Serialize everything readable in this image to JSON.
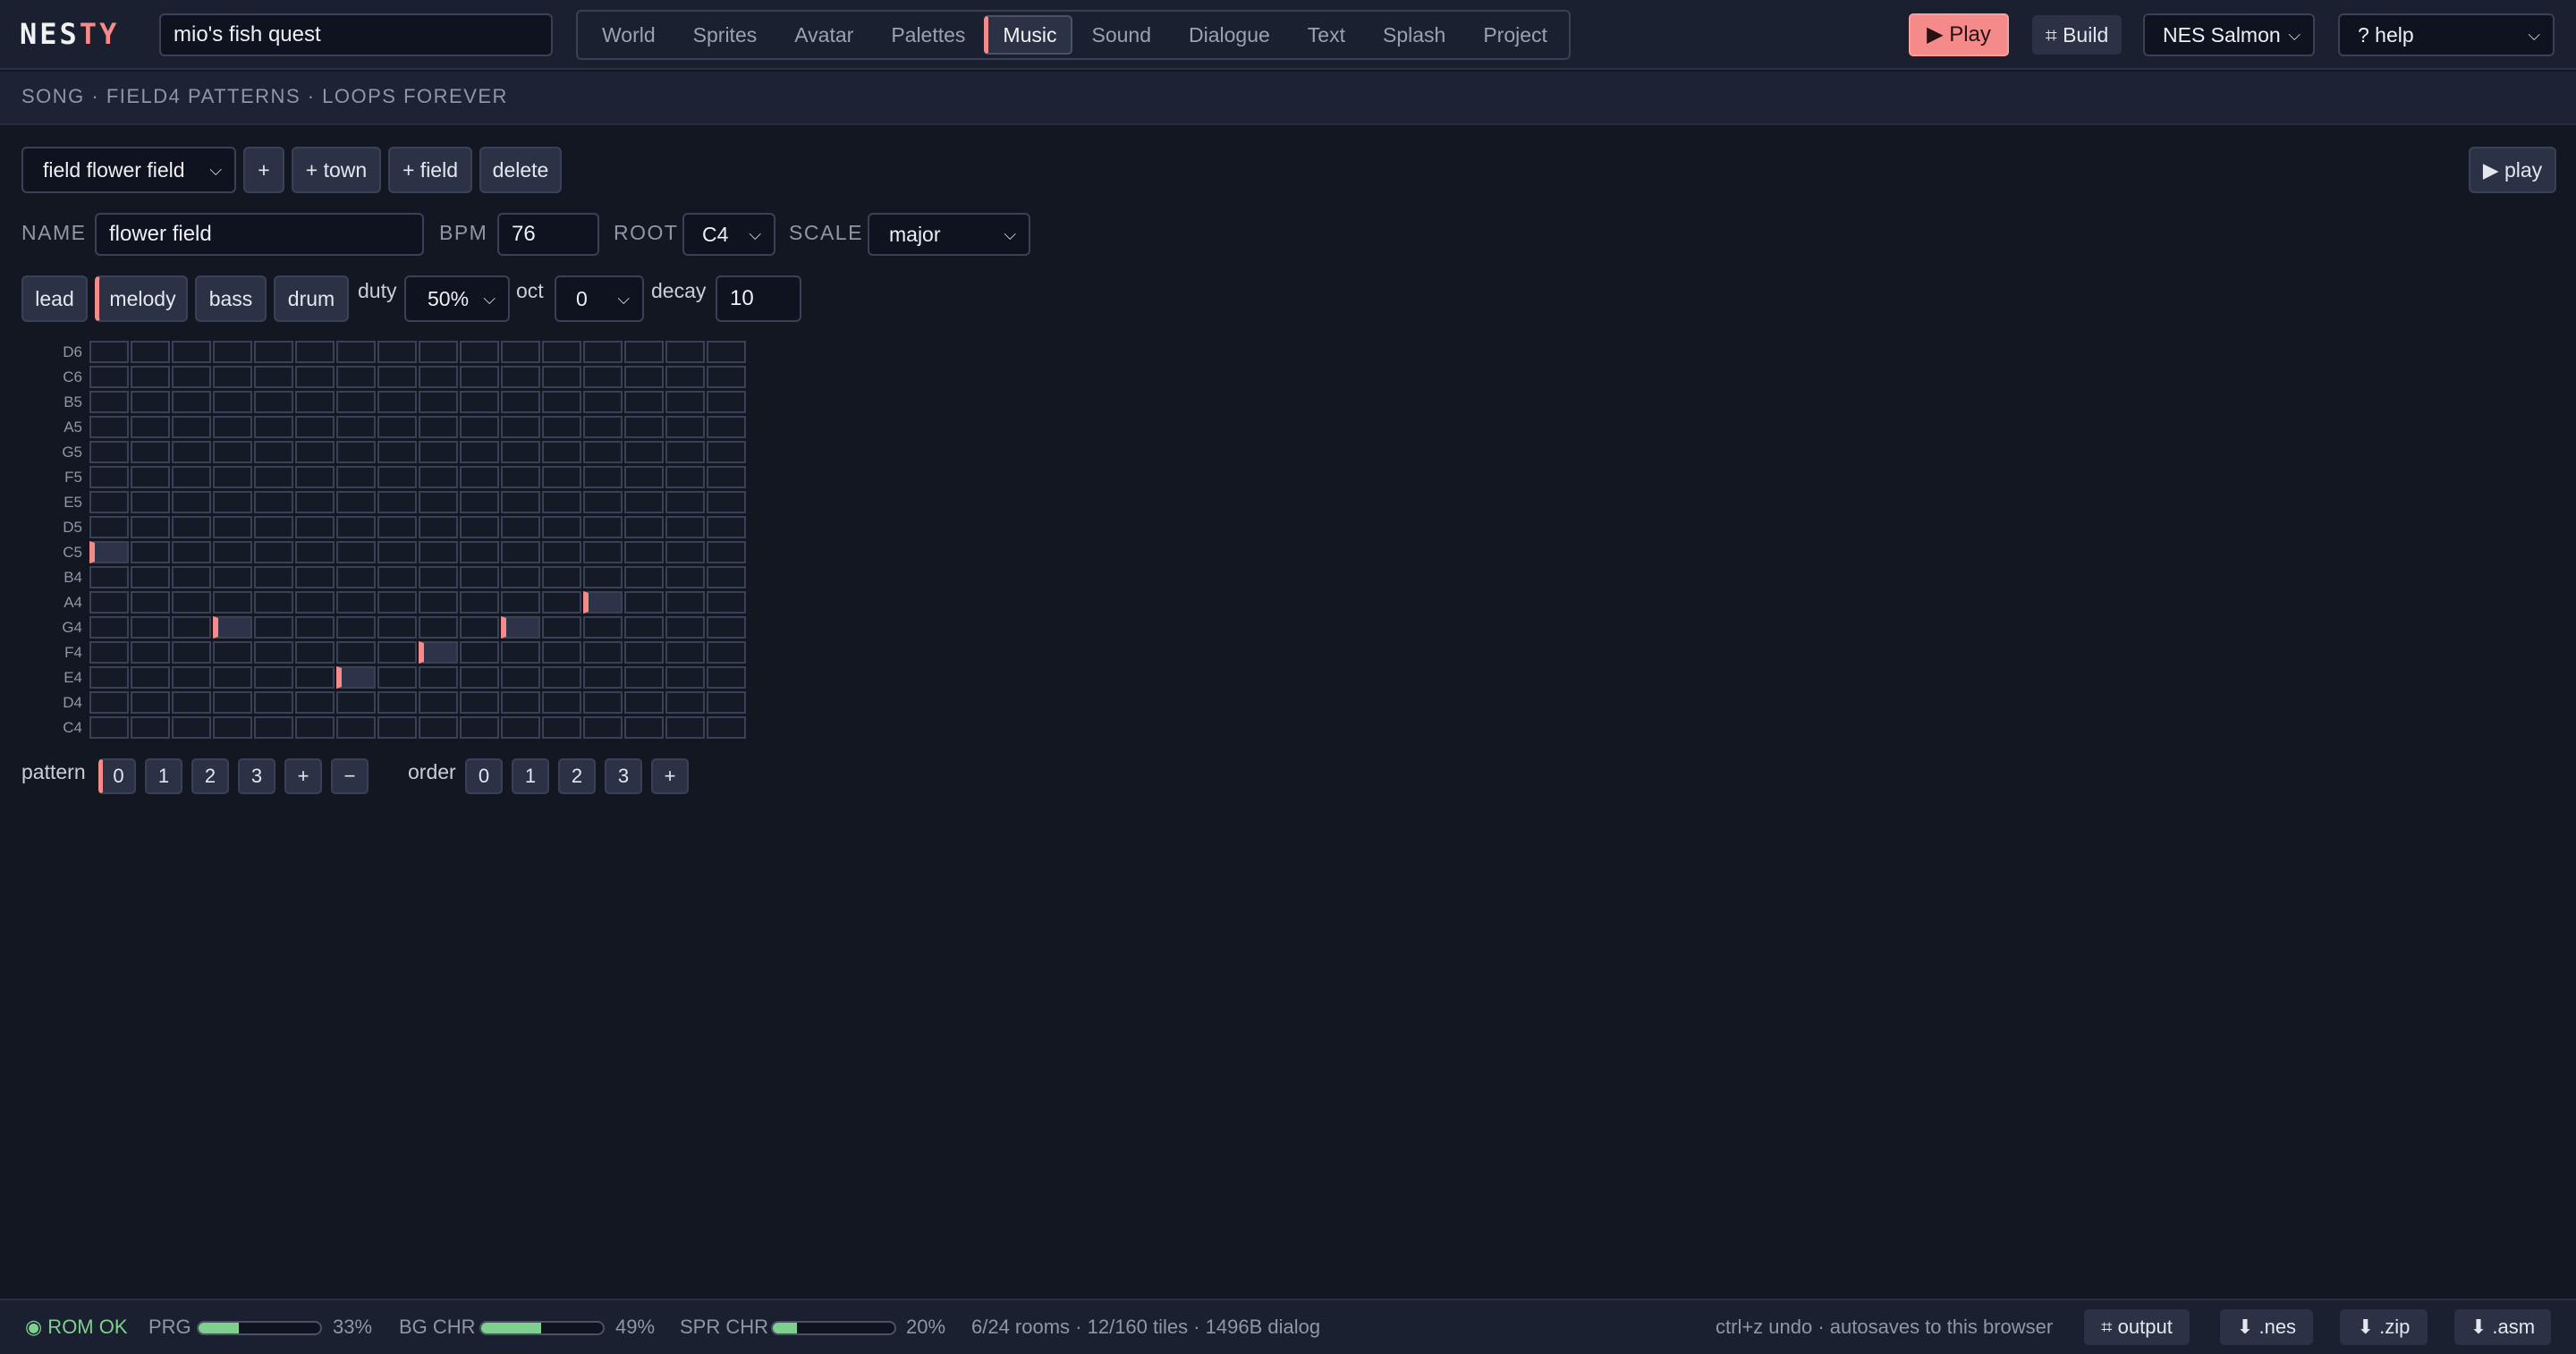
{
  "app": {
    "logo_a": "NES",
    "logo_b": "TY",
    "project_name": "mio's fish quest"
  },
  "tabs": [
    "World",
    "Sprites",
    "Avatar",
    "Palettes",
    "Music",
    "Sound",
    "Dialogue",
    "Text",
    "Splash",
    "Project"
  ],
  "active_tab": "Music",
  "toolbar": {
    "play_label": "▶ Play",
    "build_label": "⌗ Build",
    "palette_select": "NES Salmon",
    "help_select": "? help"
  },
  "subheader": "SONG · FIELD4 PATTERNS · LOOPS FOREVER",
  "song": {
    "song_select": "field flower field",
    "add_label": "+",
    "add_town_label": "+ town",
    "add_field_label": "+ field",
    "delete_label": "delete",
    "play_label": "▶ play",
    "name_label": "NAME",
    "name_value": "flower field",
    "bpm_label": "BPM",
    "bpm_value": "76",
    "root_label": "ROOT",
    "root_value": "C4",
    "scale_label": "SCALE",
    "scale_value": "major"
  },
  "channels": {
    "items": [
      "lead",
      "melody",
      "bass",
      "drum"
    ],
    "active": "melody",
    "duty_label": "duty",
    "duty_value": "50%",
    "oct_label": "oct",
    "oct_value": "0",
    "decay_label": "decay",
    "decay_value": "10"
  },
  "piano_roll": {
    "notes": [
      "D6",
      "C6",
      "B5",
      "A5",
      "G5",
      "F5",
      "E5",
      "D5",
      "C5",
      "B4",
      "A4",
      "G4",
      "F4",
      "E4",
      "D4",
      "C4"
    ],
    "steps": 16,
    "active_notes": [
      {
        "step": 0,
        "note": "C5"
      },
      {
        "step": 3,
        "note": "G4"
      },
      {
        "step": 6,
        "note": "E4"
      },
      {
        "step": 8,
        "note": "F4"
      },
      {
        "step": 10,
        "note": "G4"
      },
      {
        "step": 12,
        "note": "A4"
      }
    ]
  },
  "patterns": {
    "label": "pattern",
    "items": [
      "0",
      "1",
      "2",
      "3"
    ],
    "active": "0",
    "add_label": "+",
    "remove_label": "−"
  },
  "order": {
    "label": "order",
    "items": [
      "0",
      "1",
      "2",
      "3"
    ],
    "add_label": "+"
  },
  "footer": {
    "rom_status": "◉ ROM OK",
    "prg_label": "PRG",
    "prg_percent": "33%",
    "prg_value": 0.33,
    "bg_label": "BG CHR",
    "bg_percent": "49%",
    "bg_value": 0.49,
    "spr_label": "SPR CHR",
    "spr_percent": "20%",
    "spr_value": 0.2,
    "stats": "6/24 rooms · 12/160 tiles · 1496B dialog",
    "hint": "ctrl+z undo · autosaves to this browser",
    "output_label": "⌗ output",
    "nes_label": "⬇ .nes",
    "zip_label": "⬇ .zip",
    "asm_label": "⬇ .asm"
  },
  "colors": {
    "accent": "#f48a8a",
    "background": "#131722",
    "ok": "#7fd08f"
  }
}
